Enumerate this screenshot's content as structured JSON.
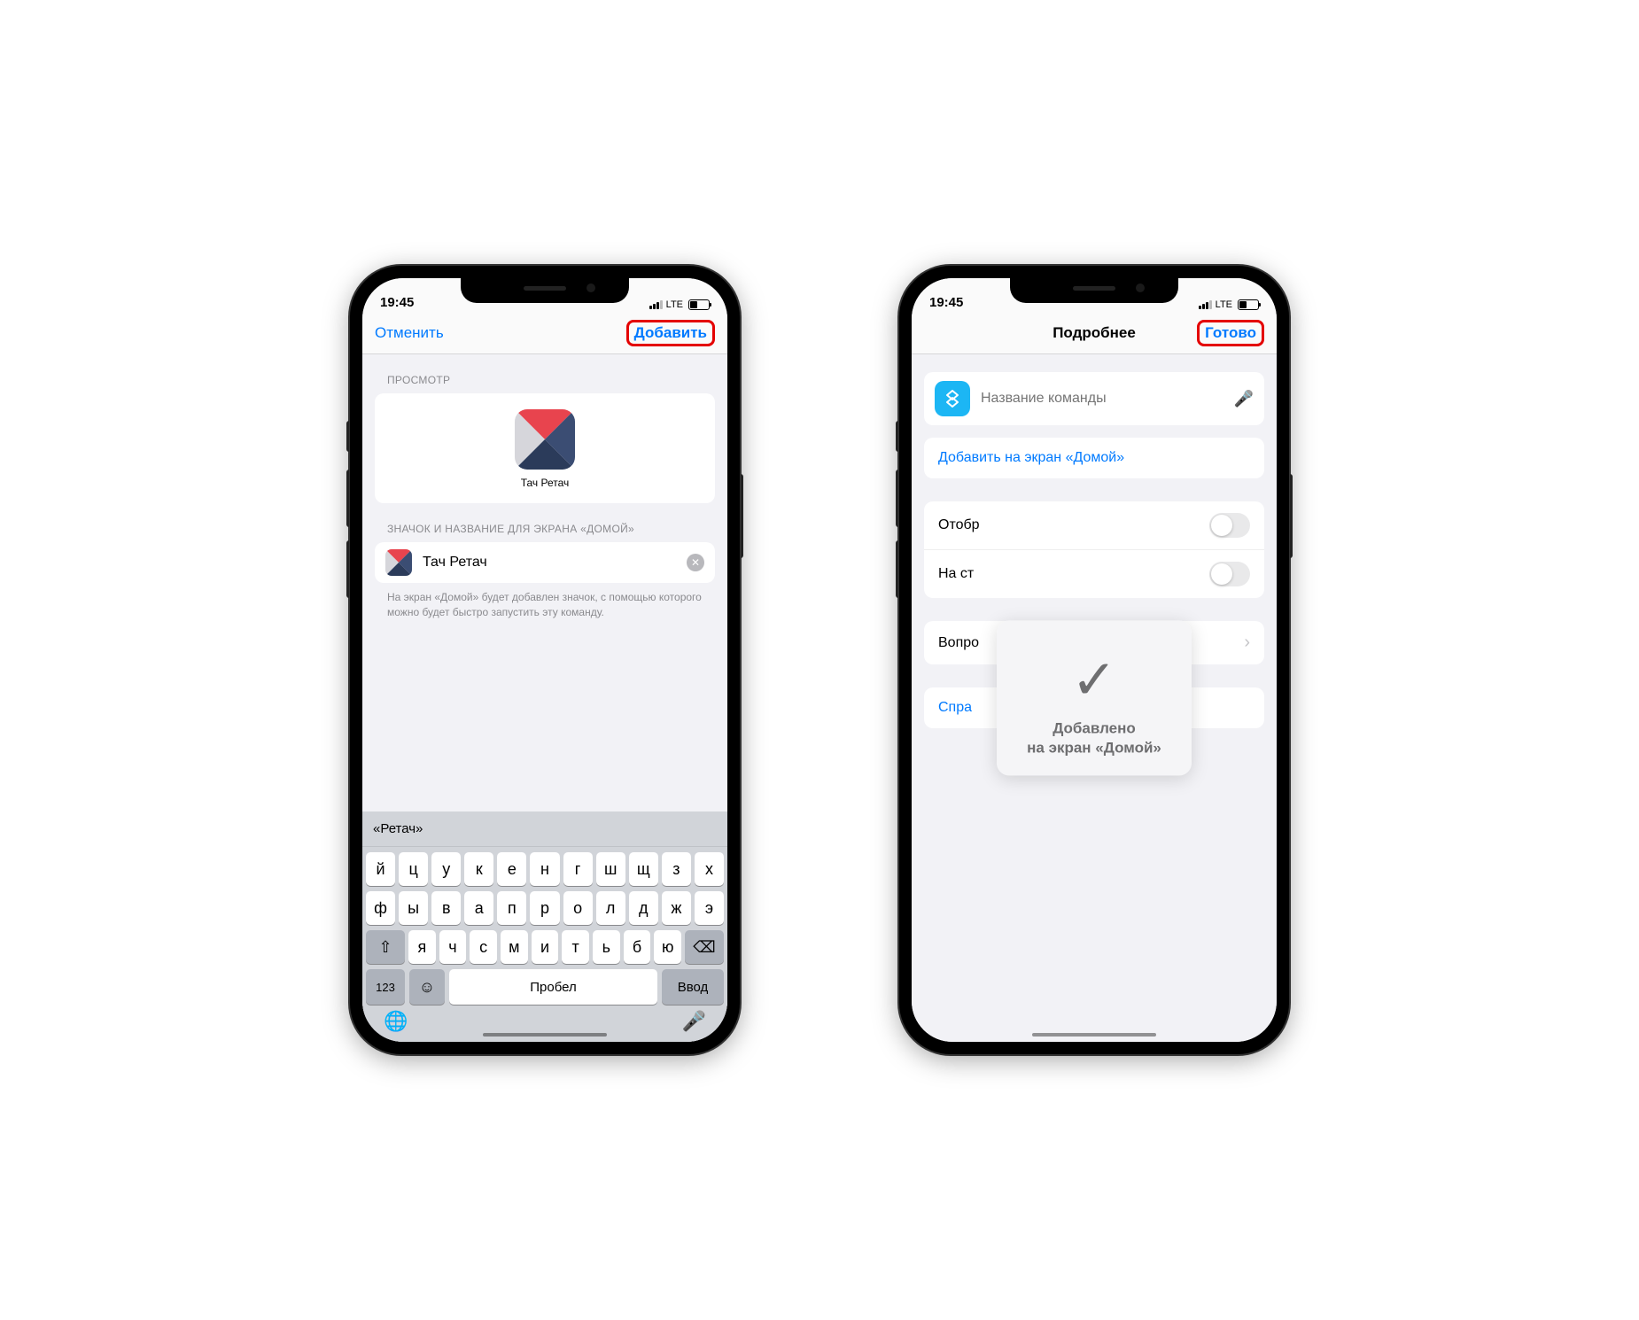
{
  "status": {
    "time": "19:45",
    "carrier": "LTE"
  },
  "left": {
    "nav": {
      "cancel": "Отменить",
      "add": "Добавить"
    },
    "section_preview": "ПРОСМОТР",
    "preview_label": "Тач Ретач",
    "section_icon_name": "ЗНАЧОК И НАЗВАНИЕ ДЛЯ ЭКРАНА «ДОМОЙ»",
    "shortcut_name": "Тач Ретач",
    "hint": "На экран «Домой» будет добавлен значок, с помощью которого можно будет быстро запустить эту команду.",
    "keyboard": {
      "suggestion": "«Ретач»",
      "row1": [
        "й",
        "ц",
        "у",
        "к",
        "е",
        "н",
        "г",
        "ш",
        "щ",
        "з",
        "х"
      ],
      "row2": [
        "ф",
        "ы",
        "в",
        "а",
        "п",
        "р",
        "о",
        "л",
        "д",
        "ж",
        "э"
      ],
      "row3": [
        "я",
        "ч",
        "с",
        "м",
        "и",
        "т",
        "ь",
        "б",
        "ю"
      ],
      "key_123": "123",
      "space": "Пробел",
      "enter": "Ввод"
    }
  },
  "right": {
    "nav": {
      "title": "Подробнее",
      "done": "Готово"
    },
    "name_placeholder": "Название команды",
    "add_to_home": "Добавить на экран «Домой»",
    "rows": {
      "show": "Отобр",
      "onpage": "На ст",
      "question": "Вопро",
      "help": "Спра"
    },
    "overlay_line1": "Добавлено",
    "overlay_line2": "на экран «Домой»"
  }
}
